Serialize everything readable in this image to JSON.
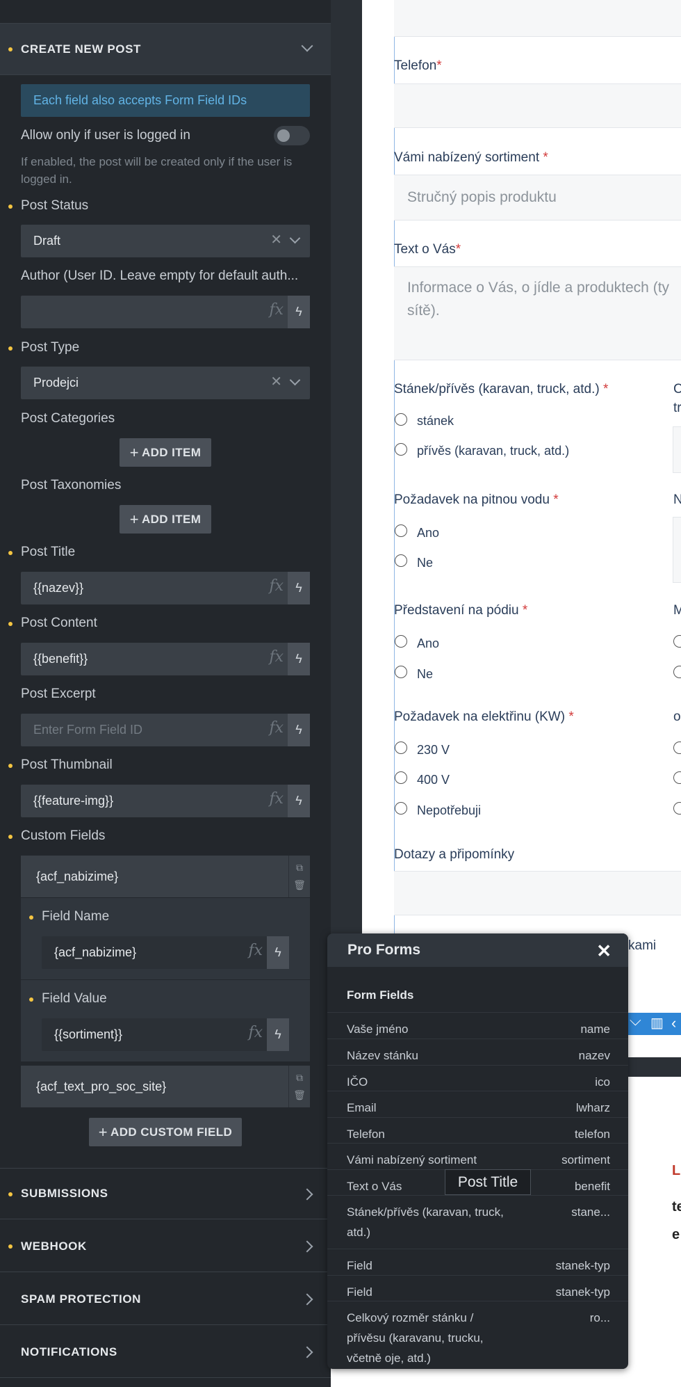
{
  "panel": {
    "section_create": "CREATE NEW POST",
    "info_text": "Each field also accepts Form Field IDs",
    "logged_in_label": "Allow only if user is logged in",
    "logged_in_help": "If enabled, the post will be created only if the user is logged in.",
    "post_status_label": "Post Status",
    "post_status_value": "Draft",
    "author_label": "Author (User ID. Leave empty for default auth...",
    "post_type_label": "Post Type",
    "post_type_value": "Prodejci",
    "post_categories_label": "Post Categories",
    "post_taxonomies_label": "Post Taxonomies",
    "add_item": "ADD ITEM",
    "post_title_label": "Post Title",
    "post_title_value": "{{nazev}}",
    "post_content_label": "Post Content",
    "post_content_value": "{{benefit}}",
    "post_excerpt_label": "Post Excerpt",
    "post_excerpt_placeholder": "Enter Form Field ID",
    "post_thumbnail_label": "Post Thumbnail",
    "post_thumbnail_value": "{{feature-img}}",
    "custom_fields_label": "Custom Fields",
    "custom_field_1": "{acf_nabizime}",
    "field_name_label": "Field Name",
    "field_name_value": "{acf_nabizime}",
    "field_value_label": "Field Value",
    "field_value_value": "{{sortiment}}",
    "custom_field_2": "{acf_text_pro_soc_site}",
    "add_custom_field": "ADD CUSTOM FIELD",
    "fx": "fx",
    "sections": [
      "SUBMISSIONS",
      "WEBHOOK",
      "SPAM PROTECTION",
      "NOTIFICATIONS"
    ]
  },
  "preview": {
    "telefon_label": "Telefon",
    "sortiment_label": "Vámi nabízený sortiment",
    "sortiment_placeholder": "Stručný popis produktu",
    "text_label": "Text o Vás",
    "text_placeholder_1": "Informace o Vás, o jídle a produktech (ty",
    "text_placeholder_2": "sítě).",
    "stanek_label": "Stánek/přívěs (karavan, truck, atd.)",
    "stanek_opt1": "stánek",
    "stanek_opt2": "přívěs (karavan, truck, atd.)",
    "voda_label": "Požadavek na pitnou vodu",
    "podium_label": "Představení na pódiu",
    "yes": "Ano",
    "no": "Ne",
    "elektrina_label": "Požadavek na elektřinu (KW)",
    "el_opt1": "230 V",
    "el_opt2": "400 V",
    "el_opt3": "Nepotřebuji",
    "dotazy_label": "Dotazy a připomínky",
    "kami_text": "kami",
    "right_col_1a": "C",
    "right_col_1b": "tr",
    "right_col_2": "N",
    "right_col_3": "M",
    "right_col_4": "o",
    "below_red": "L",
    "below_b1": "te",
    "below_b2": "e"
  },
  "popup": {
    "title": "Pro Forms",
    "subtitle": "Form Fields",
    "rows": [
      {
        "name": "Vaše jméno",
        "id": "name"
      },
      {
        "name": "Název stánku",
        "id": "nazev"
      },
      {
        "name": "IČO",
        "id": "ico"
      },
      {
        "name": "Email",
        "id": "lwharz"
      },
      {
        "name": "Telefon",
        "id": "telefon"
      },
      {
        "name": "Vámi nabízený sortiment",
        "id": "sortiment"
      },
      {
        "name": "Text o Vás",
        "id": "benefit"
      },
      {
        "name": "Stánek/přívěs (karavan, truck, atd.)",
        "id": "stane..."
      },
      {
        "name": "Field",
        "id": "stanek-typ"
      },
      {
        "name": "Field",
        "id": "stanek-typ"
      },
      {
        "name": "Celkový rozměr stánku / přívěsu (karavanu, trucku, včetně oje, atd.)",
        "id": "ro..."
      }
    ],
    "tooltip": "Post Title"
  },
  "colors": {
    "accent": "#f4c542",
    "info_bg": "#2a4a5e",
    "info_text": "#62b4e6",
    "required": "#d23a3a"
  }
}
